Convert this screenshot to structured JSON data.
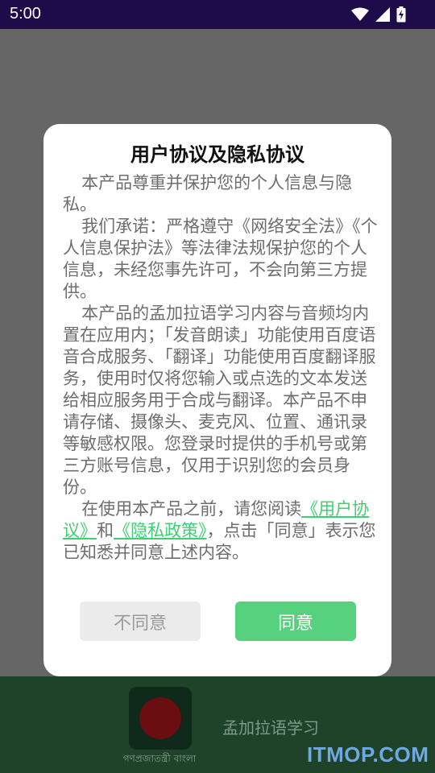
{
  "status_bar": {
    "time": "5:00",
    "icons": [
      "wifi-icon",
      "signal-icon",
      "battery-charging-icon"
    ]
  },
  "dialog": {
    "title": "用户协议及隐私协议",
    "para1": "本产品尊重并保护您的个人信息与隐私。",
    "para2": "我们承诺：严格遵守《网络安全法》《个人信息保护法》等法律法规保护您的个人信息，未经您事先许可，不会向第三方提供。",
    "para3": "本产品的孟加拉语学习内容与音频均内置在应用内；「发音朗读」功能使用百度语音合成服务、「翻译」功能使用百度翻译服务，使用时仅将您输入或点选的文本发送给相应服务用于合成与翻译。本产品不申请存储、摄像头、麦克风、位置、通讯录等敏感权限。您登录时提供的手机号或第三方账号信息，仅用于识别您的会员身份。",
    "para4_prefix": "在使用本产品之前，请您阅读",
    "user_agreement_link": "《用户协议》",
    "and_text": "和",
    "privacy_policy_link": "《隐私政策》",
    "para4_suffix": "，点击「同意」表示您已知悉并同意上述内容。",
    "disagree_label": "不同意",
    "agree_label": "同意"
  },
  "background": {
    "flag_caption": "গণপ্রজাতন্ত্রী বাংলা",
    "app_name": "孟加拉语学习",
    "watermark": "ITMOP.COM"
  },
  "colors": {
    "status_bar": "#1e0b4a",
    "accent": "#56d17d",
    "link": "#3ecf6f",
    "bottom_band": "#1e4328"
  }
}
